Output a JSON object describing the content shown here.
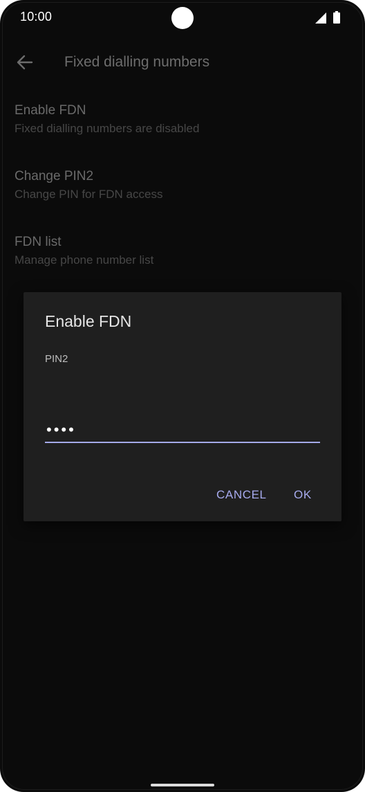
{
  "status_bar": {
    "time": "10:00"
  },
  "app_bar": {
    "title": "Fixed dialling numbers",
    "back_icon": "arrow-back-icon"
  },
  "preferences": [
    {
      "title": "Enable FDN",
      "summary": "Fixed dialling numbers are disabled"
    },
    {
      "title": "Change PIN2",
      "summary": "Change PIN for FDN access"
    },
    {
      "title": "FDN list",
      "summary": "Manage phone number list"
    }
  ],
  "dialog": {
    "title": "Enable FDN",
    "label": "PIN2",
    "pin_value": "••••",
    "cancel_label": "CANCEL",
    "ok_label": "OK"
  },
  "colors": {
    "background": "#0b0b0b",
    "dialog_background": "#1f1f1f",
    "accent": "#a7abee"
  }
}
